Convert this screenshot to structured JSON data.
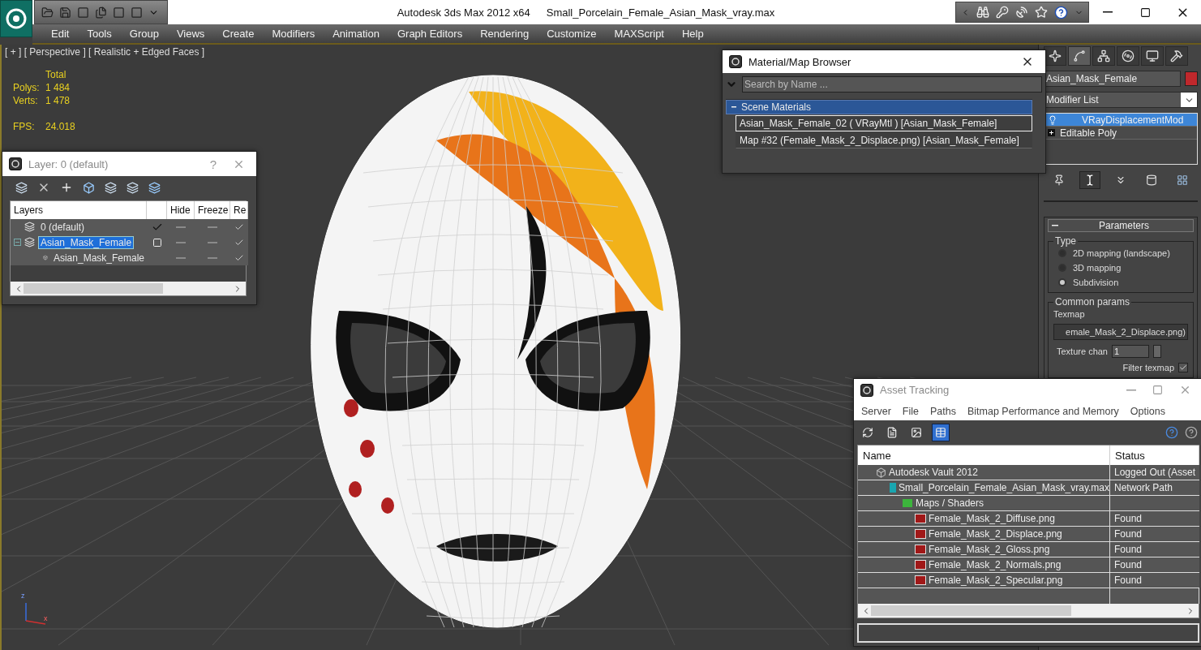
{
  "title_bar": {
    "app": "Autodesk 3ds Max  2012 x64",
    "file": "Small_Porcelain_Female_Asian_Mask_vray.max"
  },
  "menu": [
    "Edit",
    "Tools",
    "Group",
    "Views",
    "Create",
    "Modifiers",
    "Animation",
    "Graph Editors",
    "Rendering",
    "Customize",
    "MAXScript",
    "Help"
  ],
  "viewport": {
    "label": "[ + ] [ Perspective ] [ Realistic + Edged Faces ]",
    "stats_header": "Total",
    "stats": [
      {
        "label": "Polys:",
        "value": "1 484"
      },
      {
        "label": "Verts:",
        "value": "1 478"
      }
    ],
    "fps": {
      "label": "FPS:",
      "value": "24.018"
    },
    "axis": [
      "z",
      "x"
    ]
  },
  "layer_dialog": {
    "title": "Layer: 0 (default)",
    "help": "?",
    "columns": [
      "Layers",
      "",
      "Hide",
      "Freeze",
      "Re"
    ],
    "rows": [
      {
        "name": "0 (default)",
        "selected": false,
        "current": true,
        "hidden": false,
        "frozen": false,
        "renderable": true
      },
      {
        "name": "Asian_Mask_Female",
        "selected": true,
        "current": false,
        "hidden": false,
        "frozen": false,
        "renderable": true,
        "expanded": true,
        "children": [
          {
            "name": "Asian_Mask_Female",
            "selected": false,
            "hidden": false,
            "frozen": false,
            "renderable": true
          }
        ]
      }
    ]
  },
  "material_browser": {
    "title": "Material/Map Browser",
    "search_placeholder": "Search by Name ...",
    "group": {
      "label": "Scene Materials",
      "expanded": true
    },
    "items": [
      {
        "text": "Asian_Mask_Female_02  ( VRayMtl )  [Asian_Mask_Female]",
        "selected": true
      },
      {
        "text": "Map #32 (Female_Mask_2_Displace.png)  [Asian_Mask_Female]",
        "selected": false
      }
    ]
  },
  "command_panel": {
    "tabs": [
      {
        "selected": false
      },
      {
        "selected": true
      },
      {
        "selected": false
      },
      {
        "selected": false
      },
      {
        "selected": false
      },
      {
        "selected": false
      }
    ],
    "object_name": "Asian_Mask_Female",
    "modifier_list": "Modifier List",
    "stack": [
      {
        "name": "VRayDisplacementMod",
        "kind": "modifier",
        "selected": true
      },
      {
        "name": "Editable Poly",
        "kind": "base",
        "selected": false
      }
    ],
    "rollout": {
      "title": "Parameters",
      "expanded": true
    },
    "type_group": "Type",
    "type_options": [
      {
        "label": "2D mapping (landscape)",
        "selected": false
      },
      {
        "label": "3D mapping",
        "selected": false
      },
      {
        "label": "Subdivision",
        "selected": true
      }
    ],
    "common_group": "Common params",
    "texmap_label": "Texmap",
    "texmap_value": "emale_Mask_2_Displace.png)",
    "texture_chan": {
      "label": "Texture chan",
      "value": "1"
    },
    "filter_texmap": {
      "label": "Filter texmap",
      "checked": true
    }
  },
  "asset_tracking": {
    "title": "Asset Tracking",
    "menu": [
      "Server",
      "File",
      "Paths",
      "Bitmap Performance and Memory",
      "Options"
    ],
    "toolbar": [
      {
        "selected": false
      },
      {
        "selected": false
      },
      {
        "selected": false
      },
      {
        "selected": true
      }
    ],
    "columns": [
      "Name",
      "Status"
    ],
    "rows": [
      {
        "kind": "vault",
        "name": "Autodesk Vault 2012",
        "status": "Logged Out (Asset",
        "children": [
          {
            "kind": "scene",
            "name": "Small_Porcelain_Female_Asian_Mask_vray.max",
            "status": "Network Path",
            "children": [
              {
                "kind": "folder",
                "name": "Maps / Shaders",
                "children": [
                  {
                    "kind": "png",
                    "name": "Female_Mask_2_Diffuse.png",
                    "status": "Found"
                  },
                  {
                    "kind": "png",
                    "name": "Female_Mask_2_Displace.png",
                    "status": "Found"
                  },
                  {
                    "kind": "png",
                    "name": "Female_Mask_2_Gloss.png",
                    "status": "Found"
                  },
                  {
                    "kind": "png",
                    "name": "Female_Mask_2_Normals.png",
                    "status": "Found"
                  },
                  {
                    "kind": "png",
                    "name": "Female_Mask_2_Specular.png",
                    "status": "Found"
                  }
                ]
              }
            ]
          }
        ]
      }
    ]
  }
}
